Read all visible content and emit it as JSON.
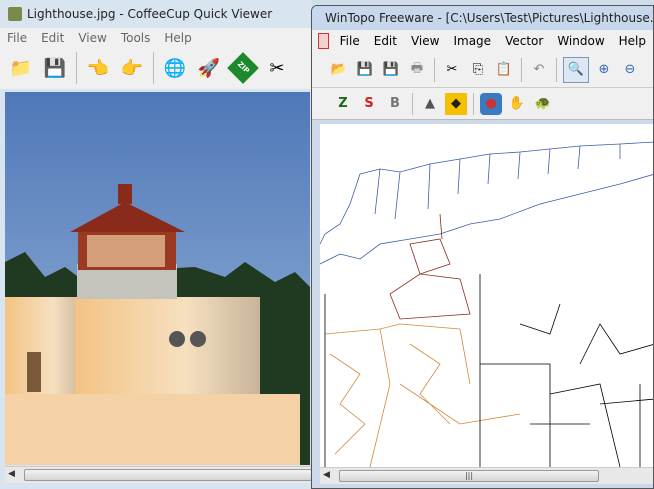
{
  "left_window": {
    "title": "Lighthouse.jpg - CoffeeCup Quick Viewer",
    "menu": [
      "File",
      "Edit",
      "View",
      "Tools",
      "Help"
    ],
    "toolbar": [
      {
        "icon": "folder-icon",
        "glyph": "📁"
      },
      {
        "icon": "floppy-disk-icon",
        "glyph": "💾"
      },
      {
        "icon": "hand-left-icon",
        "glyph": "👈"
      },
      {
        "icon": "hand-right-icon",
        "glyph": "👉"
      },
      {
        "icon": "web-email-icon",
        "glyph": "🌐"
      },
      {
        "icon": "rocket-icon",
        "glyph": "🚀"
      },
      {
        "icon": "zip-icon",
        "glyph": "ZIP"
      },
      {
        "icon": "scissors-icon",
        "glyph": "✂"
      }
    ]
  },
  "right_window": {
    "title": "WinTopo Freeware - [C:\\Users\\Test\\Pictures\\Lighthouse.jpg]",
    "menu": [
      "File",
      "Edit",
      "View",
      "Image",
      "Vector",
      "Window",
      "Help"
    ],
    "toolbar1": [
      {
        "icon": "open-folder-icon",
        "glyph": "📂"
      },
      {
        "icon": "save-icon",
        "glyph": "💾"
      },
      {
        "icon": "save-as-icon",
        "glyph": "💾"
      },
      {
        "icon": "print-icon",
        "glyph": "🖶"
      },
      {
        "icon": "cut-icon",
        "glyph": "✂"
      },
      {
        "icon": "copy-icon",
        "glyph": "⎘"
      },
      {
        "icon": "paste-icon",
        "glyph": "📋"
      },
      {
        "icon": "undo-icon",
        "glyph": "↶"
      },
      {
        "icon": "zoom-magnifier-icon",
        "glyph": "🔍"
      },
      {
        "icon": "zoom-in-icon",
        "glyph": "⊕"
      },
      {
        "icon": "zoom-out-icon",
        "glyph": "⊖"
      }
    ],
    "toolbar2": [
      {
        "icon": "zhang-suen-thinning-icon",
        "glyph": "Z"
      },
      {
        "icon": "stentiford-thinning-icon",
        "glyph": "S"
      },
      {
        "icon": "one-touch-thinning-icon",
        "glyph": "B"
      },
      {
        "icon": "grayscale-icon",
        "glyph": "▲"
      },
      {
        "icon": "polygon-icon",
        "glyph": "◆"
      },
      {
        "icon": "colour-icon",
        "glyph": "●"
      },
      {
        "icon": "hand-tool-icon",
        "glyph": "✋"
      },
      {
        "icon": "turtle-icon",
        "glyph": "🐢"
      }
    ]
  },
  "colors": {
    "sky": "#5f86c2",
    "trace_blue": "#3b5ea8",
    "trace_orange": "#d08a3a",
    "trace_red": "#8a2a1a"
  }
}
